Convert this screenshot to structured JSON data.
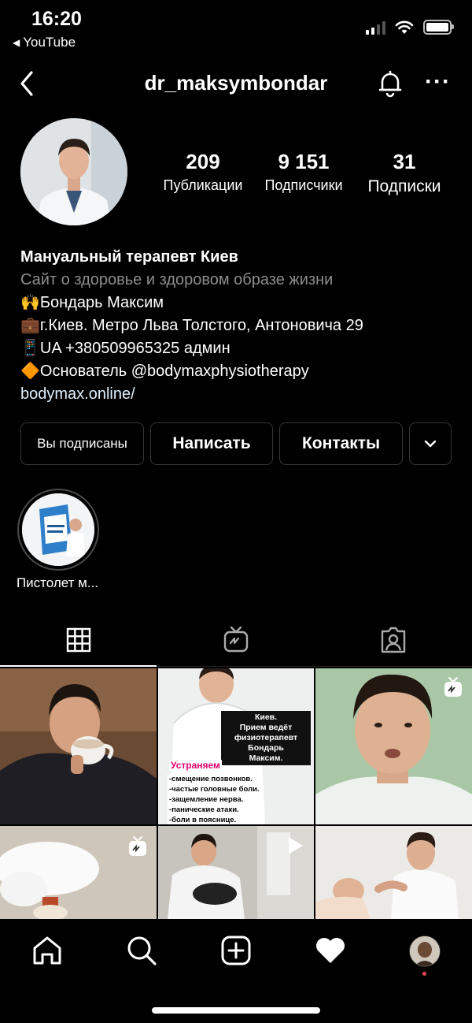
{
  "status_bar": {
    "time": "16:20",
    "back_app": "YouTube"
  },
  "header": {
    "username": "dr_maksymbondar"
  },
  "stats": [
    {
      "value": "209",
      "label": "Публикации"
    },
    {
      "value": "9 151",
      "label": "Подписчики"
    },
    {
      "value": "31",
      "label": "Подписки"
    }
  ],
  "bio": {
    "name": "Мануальный терапевт Киев",
    "category": "Сайт о здоровье и здоровом образе жизни",
    "lines": [
      {
        "emoji": "🙌",
        "text": "Бондарь Максим"
      },
      {
        "emoji": "💼",
        "text": "г.Киев. Метро Льва Толстого, Антоновича 29"
      },
      {
        "emoji": "📱",
        "text": "UA +380509965325 админ"
      },
      {
        "emoji": "🔶",
        "text": "Основатель @bodymaxphysiotherapy"
      }
    ],
    "link": "bodymax.online/"
  },
  "buttons": {
    "following": "Вы подписаны",
    "message": "Написать",
    "contacts": "Контакты"
  },
  "highlights": [
    {
      "label": "Пистолет м..."
    }
  ],
  "post2": {
    "title": "Киев.\nПрием ведёт\nфизиотерапевт Бондарь\nМаксим.",
    "heading": "Устраняем",
    "items": [
      "-смещение позвонков.",
      "-частые головные боли.",
      "-защемление нерва.",
      "-панические атаки.",
      "-боли в пояснице."
    ]
  },
  "colors": {
    "background": "#000000",
    "accent_notification": "#ed4956",
    "heading_pink": "#e0006e"
  }
}
